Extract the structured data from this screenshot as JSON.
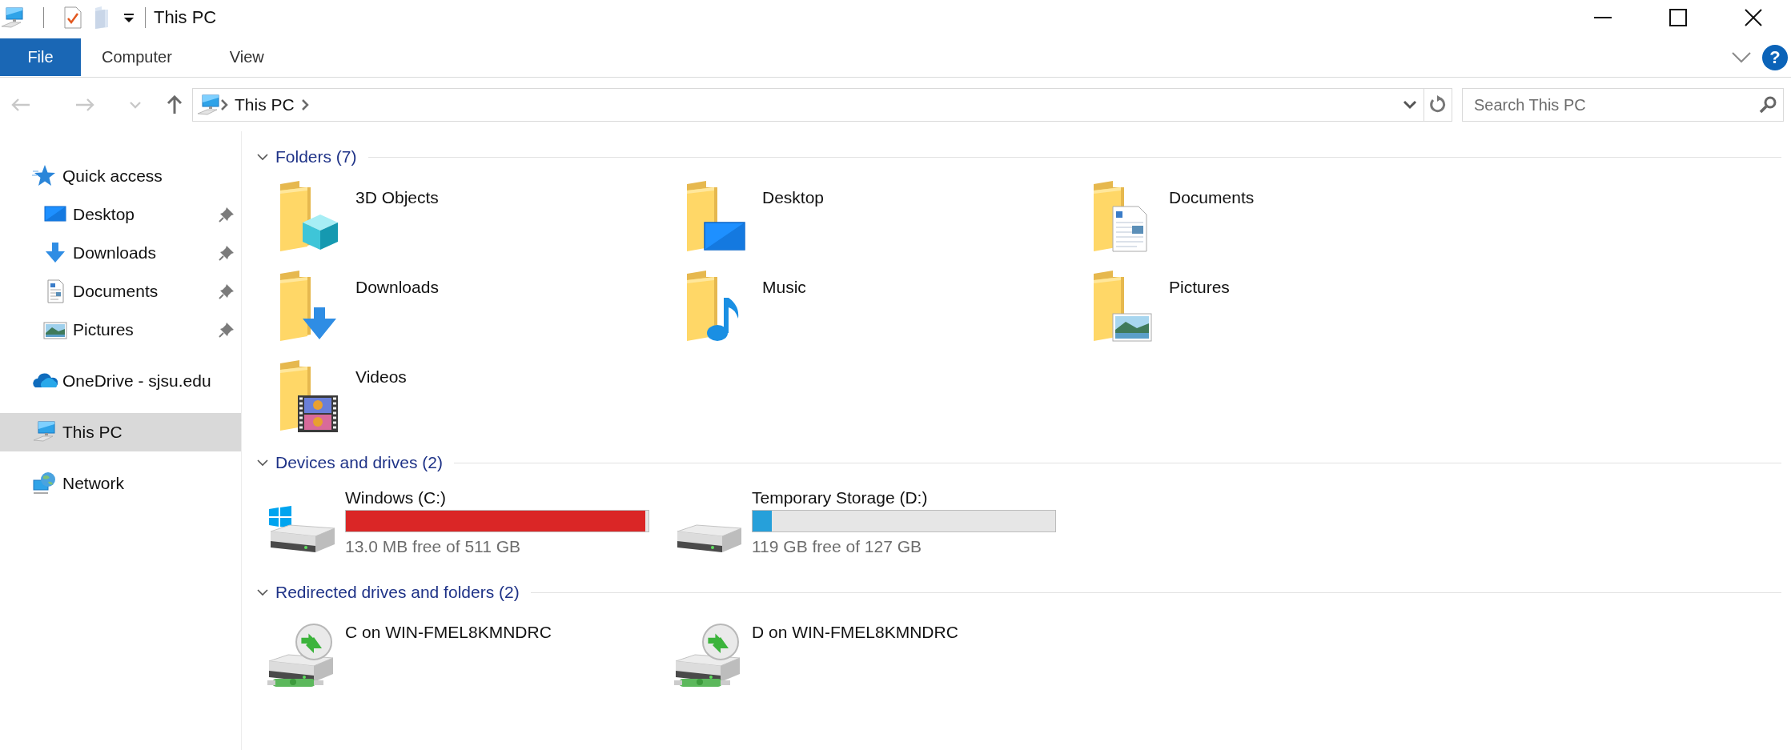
{
  "title_bar": {
    "title": "This PC"
  },
  "ribbon": {
    "tabs": [
      {
        "label": "File",
        "kind": "file-menu",
        "selected": false
      },
      {
        "label": "Computer",
        "kind": "tab",
        "selected": false
      },
      {
        "label": "View",
        "kind": "tab",
        "selected": false
      }
    ],
    "help": "?"
  },
  "navigation": [
    {
      "kind": "back",
      "disabled": true
    },
    {
      "kind": "forward",
      "disabled": true
    },
    {
      "kind": "recent",
      "disabled": true
    },
    {
      "kind": "up",
      "disabled": false
    }
  ],
  "address_bar": {
    "path": [
      "This PC"
    ]
  },
  "search": {
    "placeholder": "Search This PC"
  },
  "sidebar": {
    "items": [
      {
        "label": "Quick access",
        "kind": "quick-access",
        "selected": false,
        "children": [
          {
            "label": "Desktop",
            "kind": "desktop",
            "pinned": true,
            "selected": false
          },
          {
            "label": "Downloads",
            "kind": "downloads",
            "pinned": true,
            "selected": false
          },
          {
            "label": "Documents",
            "kind": "documents",
            "pinned": true,
            "selected": false
          },
          {
            "label": "Pictures",
            "kind": "pictures",
            "pinned": true,
            "selected": false
          }
        ]
      },
      {
        "label": "OneDrive - sjsu.edu",
        "kind": "cloud",
        "selected": false
      },
      {
        "label": "This PC",
        "kind": "pc",
        "selected": true
      },
      {
        "label": "Network",
        "kind": "network",
        "selected": false
      }
    ]
  },
  "sections": [
    {
      "title": "Folders (7)",
      "expanded": true,
      "items": [
        {
          "kind": "cube",
          "name": "3D Objects"
        },
        {
          "kind": "desktop",
          "name": "Desktop"
        },
        {
          "kind": "documents",
          "name": "Documents"
        },
        {
          "kind": "downloads",
          "name": "Downloads"
        },
        {
          "kind": "music",
          "name": "Music"
        },
        {
          "kind": "pictures",
          "name": "Pictures"
        },
        {
          "kind": "videos",
          "name": "Videos"
        }
      ]
    },
    {
      "title": "Devices and drives (2)",
      "expanded": true,
      "items": [
        {
          "kind": "system-drive",
          "name": "Windows (C:)",
          "level": 0.99,
          "free": "13.0 MB free of 511 GB"
        },
        {
          "kind": "drive",
          "name": "Temporary Storage (D:)",
          "level": 0.063,
          "free": "119 GB free of 127 GB"
        }
      ]
    },
    {
      "title": "Redirected drives and folders (2)",
      "expanded": true,
      "items": [
        {
          "kind": "redirected",
          "name": "C on WIN-FMEL8KMNDRC"
        },
        {
          "kind": "redirected",
          "name": "D on WIN-FMEL8KMNDRC"
        }
      ]
    }
  ]
}
